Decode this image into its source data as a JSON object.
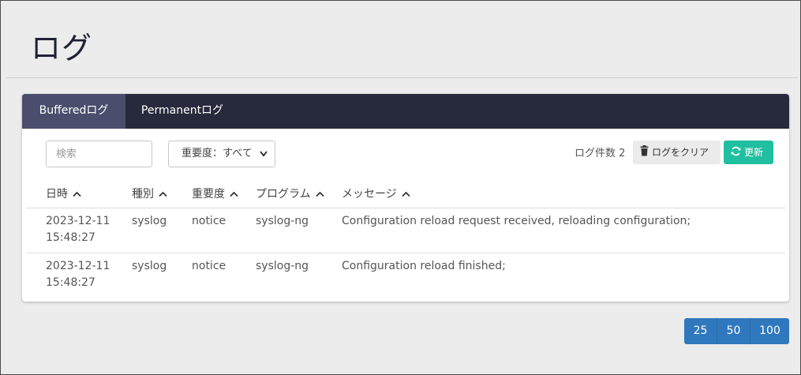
{
  "page": {
    "title": "ログ"
  },
  "tabs": [
    {
      "label": "Bufferedログ",
      "active": true
    },
    {
      "label": "Permanentログ",
      "active": false
    }
  ],
  "toolbar": {
    "search_placeholder": "検索",
    "severity_selected": "重要度：すべて",
    "log_count_label": "ログ件数 2",
    "clear_label": "ログをクリア",
    "refresh_label": "更新"
  },
  "table": {
    "columns": [
      "日時",
      "種別",
      "重要度",
      "プログラム",
      "メッセージ"
    ],
    "rows": [
      {
        "date": "2023-12-11",
        "time": "15:48:27",
        "type": "syslog",
        "severity": "notice",
        "program": "syslog-ng",
        "message": "Configuration reload request received, reloading configuration;"
      },
      {
        "date": "2023-12-11",
        "time": "15:48:27",
        "type": "syslog",
        "severity": "notice",
        "program": "syslog-ng",
        "message": "Configuration reload finished;"
      }
    ]
  },
  "pagination": {
    "sizes": [
      "25",
      "50",
      "100"
    ]
  },
  "colors": {
    "tabbar": "#272a3c",
    "tab_active": "#4a4e6c",
    "refresh_button": "#1fbf9f",
    "pager": "#2f78be"
  }
}
